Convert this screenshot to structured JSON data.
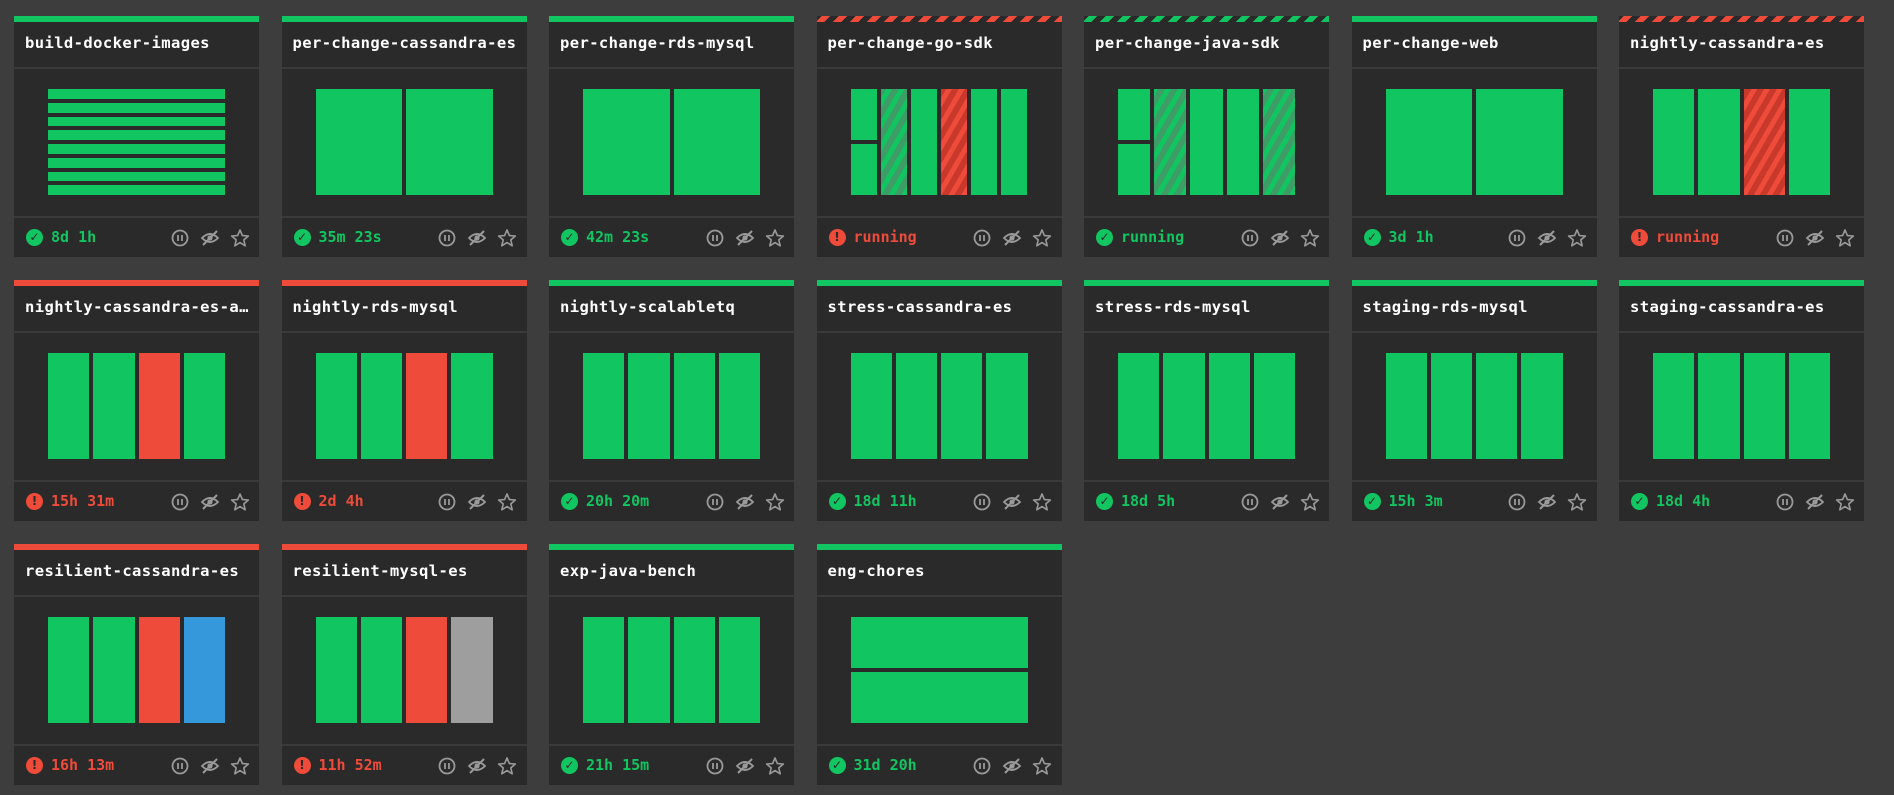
{
  "colors": {
    "succeeded": "#11c560",
    "failed": "#ef4b3a",
    "aborted": "#3498db",
    "pending": "#9e9e9e",
    "card": "#2a2a2a",
    "background": "#3d3d3d"
  },
  "icons": {
    "ok": "check-circle-icon",
    "err": "exclamation-circle-icon",
    "pause": "pause-icon",
    "hide": "eye-slash-icon",
    "favorite": "star-icon"
  },
  "pipelines": [
    {
      "name": "build-docker-images",
      "status_kind": "ok",
      "status_text": "8d 1h",
      "bar": "solid-green",
      "layout": "rows",
      "jobs": [
        "green",
        "green",
        "green",
        "green",
        "green",
        "green",
        "green",
        "green"
      ]
    },
    {
      "name": "per-change-cassandra-es",
      "status_kind": "ok",
      "status_text": "35m 23s",
      "bar": "solid-green",
      "layout": "cols",
      "jobs": [
        "green",
        "green"
      ]
    },
    {
      "name": "per-change-rds-mysql",
      "status_kind": "ok",
      "status_text": "42m 23s",
      "bar": "solid-green",
      "layout": "cols",
      "jobs": [
        "green",
        "green"
      ]
    },
    {
      "name": "per-change-go-sdk",
      "status_kind": "err",
      "status_text": "running",
      "bar": "stripe-red",
      "layout": "cols",
      "first_split": true,
      "jobs": [
        "green",
        "green-stripe",
        "green",
        "red-stripe",
        "green",
        "green"
      ]
    },
    {
      "name": "per-change-java-sdk",
      "status_kind": "ok",
      "status_text": "running",
      "bar": "stripe-green",
      "layout": "cols",
      "first_split": true,
      "jobs": [
        "green",
        "green-stripe",
        "green",
        "green",
        "green-stripe"
      ]
    },
    {
      "name": "per-change-web",
      "status_kind": "ok",
      "status_text": "3d 1h",
      "bar": "solid-green",
      "layout": "cols",
      "jobs": [
        "green",
        "green"
      ]
    },
    {
      "name": "nightly-cassandra-es",
      "status_kind": "err",
      "status_text": "running",
      "bar": "stripe-red",
      "layout": "cols",
      "jobs": [
        "green",
        "green",
        "red-stripe",
        "green"
      ]
    },
    {
      "name": "nightly-cassandra-es-archival",
      "status_kind": "err",
      "status_text": "15h 31m",
      "bar": "solid-red",
      "layout": "cols",
      "jobs": [
        "green",
        "green",
        "red",
        "green"
      ]
    },
    {
      "name": "nightly-rds-mysql",
      "status_kind": "err",
      "status_text": "2d 4h",
      "bar": "solid-red",
      "layout": "cols",
      "jobs": [
        "green",
        "green",
        "red",
        "green"
      ]
    },
    {
      "name": "nightly-scalabletq",
      "status_kind": "ok",
      "status_text": "20h 20m",
      "bar": "solid-green",
      "layout": "cols",
      "jobs": [
        "green",
        "green",
        "green",
        "green"
      ]
    },
    {
      "name": "stress-cassandra-es",
      "status_kind": "ok",
      "status_text": "18d 11h",
      "bar": "solid-green",
      "layout": "cols",
      "jobs": [
        "green",
        "green",
        "green",
        "green"
      ]
    },
    {
      "name": "stress-rds-mysql",
      "status_kind": "ok",
      "status_text": "18d 5h",
      "bar": "solid-green",
      "layout": "cols",
      "jobs": [
        "green",
        "green",
        "green",
        "green"
      ]
    },
    {
      "name": "staging-rds-mysql",
      "status_kind": "ok",
      "status_text": "15h 3m",
      "bar": "solid-green",
      "layout": "cols",
      "jobs": [
        "green",
        "green",
        "green",
        "green"
      ]
    },
    {
      "name": "staging-cassandra-es",
      "status_kind": "ok",
      "status_text": "18d 4h",
      "bar": "solid-green",
      "layout": "cols",
      "jobs": [
        "green",
        "green",
        "green",
        "green"
      ]
    },
    {
      "name": "resilient-cassandra-es",
      "status_kind": "err",
      "status_text": "16h 13m",
      "bar": "solid-red",
      "layout": "cols",
      "jobs": [
        "green",
        "green",
        "red",
        "blue"
      ]
    },
    {
      "name": "resilient-mysql-es",
      "status_kind": "err",
      "status_text": "11h 52m",
      "bar": "solid-red",
      "layout": "cols",
      "jobs": [
        "green",
        "green",
        "red",
        "gray"
      ]
    },
    {
      "name": "exp-java-bench",
      "status_kind": "ok",
      "status_text": "21h 15m",
      "bar": "solid-green",
      "layout": "cols",
      "jobs": [
        "green",
        "green",
        "green",
        "green"
      ]
    },
    {
      "name": "eng-chores",
      "status_kind": "ok",
      "status_text": "31d 20h",
      "bar": "solid-green",
      "layout": "rows",
      "jobs": [
        "green",
        "green"
      ]
    }
  ]
}
